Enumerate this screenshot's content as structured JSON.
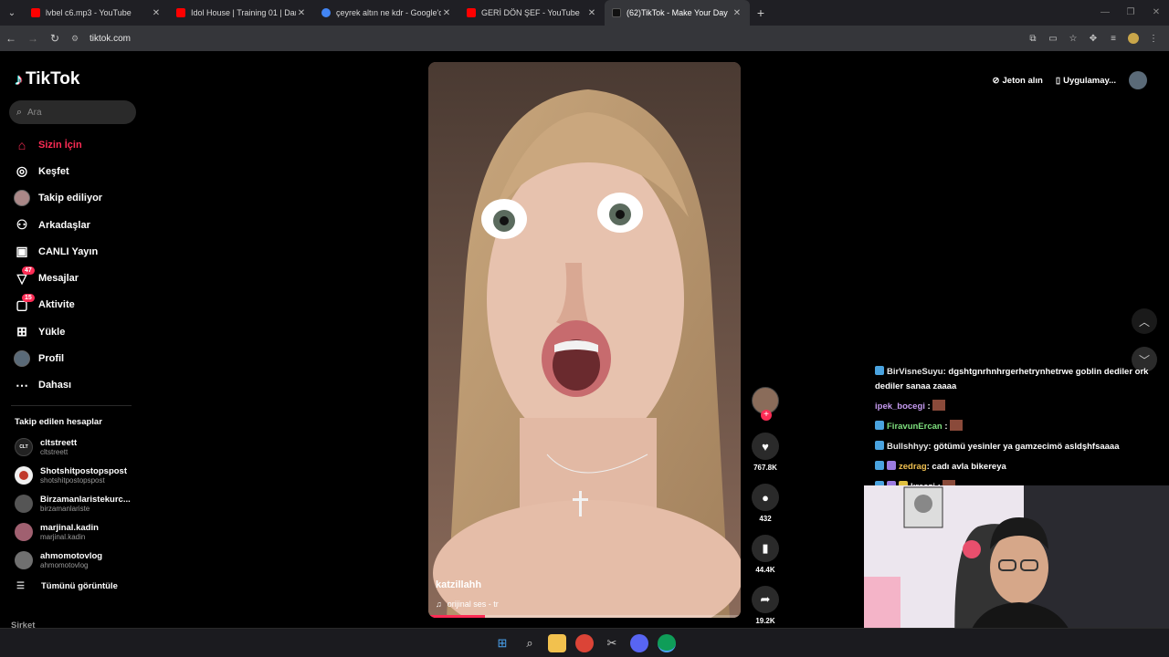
{
  "browser": {
    "tabs": [
      {
        "title": "lvbel c6.mp3 - YouTube",
        "favicon_color": "#ff0000",
        "active": false
      },
      {
        "title": "Idol House | Training 01 | Dans",
        "favicon_color": "#ff0000",
        "active": false
      },
      {
        "title": "çeyrek altın ne kdr - Google'da",
        "favicon_color": "#4285f4",
        "active": false
      },
      {
        "title": "GERİ DÖN ŞEF - YouTube",
        "favicon_color": "#ff0000",
        "active": false
      },
      {
        "title": "(62)TikTok - Make Your Day",
        "favicon_color": "#000000",
        "active": true
      }
    ],
    "url": "tiktok.com"
  },
  "sidebar": {
    "logo_text": "TikTok",
    "search_placeholder": "Ara",
    "nav": [
      {
        "label": "Sizin İçin",
        "icon": "home-icon",
        "active": true
      },
      {
        "label": "Keşfet",
        "icon": "compass-icon"
      },
      {
        "label": "Takip ediliyor",
        "icon": "avatar"
      },
      {
        "label": "Arkadaşlar",
        "icon": "friends-icon"
      },
      {
        "label": "CANLI Yayın",
        "icon": "live-icon"
      },
      {
        "label": "Mesajlar",
        "icon": "messages-icon",
        "badge": "47"
      },
      {
        "label": "Aktivite",
        "icon": "activity-icon",
        "badge": "15"
      },
      {
        "label": "Yükle",
        "icon": "upload-icon"
      },
      {
        "label": "Profil",
        "icon": "avatar"
      },
      {
        "label": "Dahası",
        "icon": "more-icon"
      }
    ],
    "following_title": "Takip edilen hesaplar",
    "following": [
      {
        "name": "cltstreett",
        "handle": "cltstreett",
        "avatar_text": "CLT",
        "color": "#222"
      },
      {
        "name": "Shotshitpostopspost",
        "handle": "shotshitpostopspost",
        "avatar_text": "",
        "color": "#f0f0f0"
      },
      {
        "name": "Birzamanlaristekurc...",
        "handle": "birzamanlariste",
        "avatar_text": "",
        "color": "#555"
      },
      {
        "name": "marjinal.kadin",
        "handle": "marjinal.kadin",
        "avatar_text": "",
        "color": "#a06070"
      },
      {
        "name": "ahmomotovlog",
        "handle": "ahmomotovlog",
        "avatar_text": "",
        "color": "#707070"
      }
    ],
    "see_all": "Tümünü görüntüle",
    "company": "Şirket"
  },
  "header": {
    "coins": "Jeton alın",
    "app": "Uygulamay..."
  },
  "video": {
    "author": "katzillahh",
    "music": "orijinal ses - tr",
    "progress": 0.18
  },
  "actions": {
    "likes": "767.8K",
    "comments": "432",
    "saves": "44.4K",
    "shares": "19.2K"
  },
  "chat": [
    {
      "user": "BirVisneSuyu",
      "color": "#e8e8e8",
      "text": ": dgshtgnrhnhrgerhetrynhetrwe goblin dediler ork dediler sanaa zaaaa",
      "emote": false
    },
    {
      "user": "ipek_bocegi",
      "color": "#c79bf2",
      "text": " :",
      "emote": true
    },
    {
      "user": "FiravunErcan",
      "color": "#7ee07e",
      "text": " :",
      "emote": true
    },
    {
      "user": "Bullshhyy",
      "color": "#e8e8e8",
      "text": ": götümü yesinler ya gamzecimö asldşhfsaaaa",
      "emote": false
    },
    {
      "user": "zedrag",
      "color": "#f0c050",
      "text": ": cadı avla bikereya",
      "emote": false
    },
    {
      "user": "kreazi",
      "color": "#e8e8e8",
      "text": " :",
      "emote": true
    }
  ]
}
